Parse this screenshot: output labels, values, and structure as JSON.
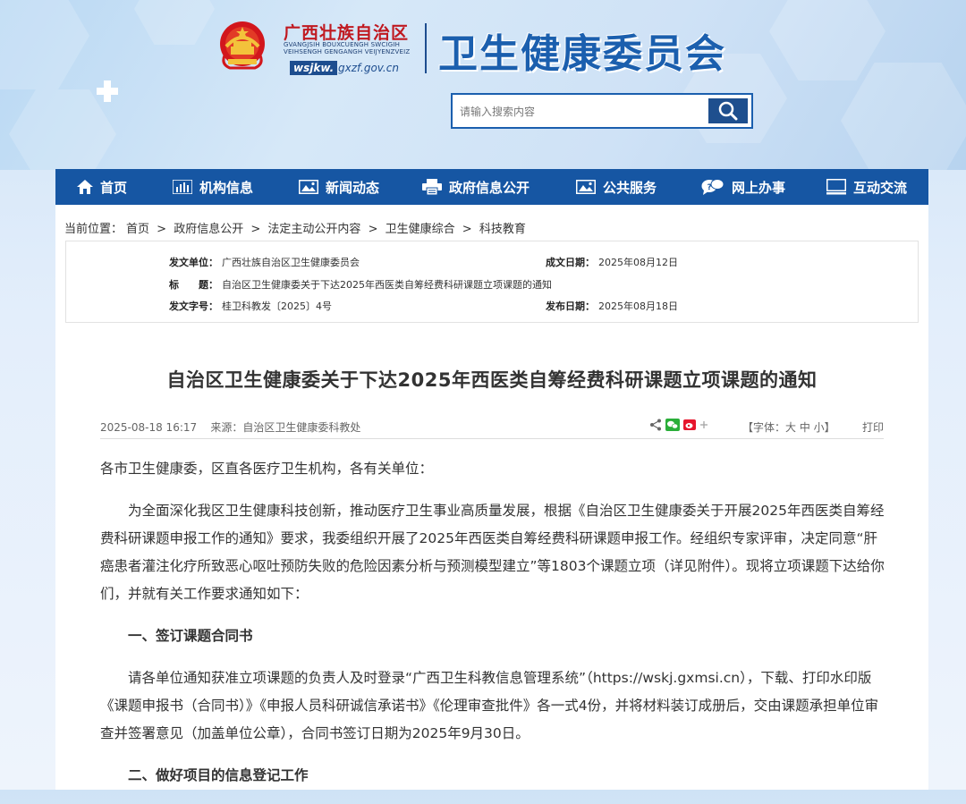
{
  "header": {
    "region_cn": "广西壮族自治区",
    "region_zh_lines": [
      "GVANGJSIH BOUXCUENGH SWCIGIH",
      "VEIHSENGH GENGANGH VEIJYENZVEIZ"
    ],
    "url_prefix": "wsjkw.",
    "url_rest": "gxzf.gov.cn",
    "org_title": "卫生健康委员会"
  },
  "search": {
    "placeholder": "请输入搜索内容",
    "button_icon": "search-icon"
  },
  "nav": {
    "items": [
      {
        "label": "首页",
        "icon": "home-icon"
      },
      {
        "label": "机构信息",
        "icon": "bar-chart-icon"
      },
      {
        "label": "新闻动态",
        "icon": "image-icon"
      },
      {
        "label": "政府信息公开",
        "icon": "printer-icon"
      },
      {
        "label": "公共服务",
        "icon": "image-icon"
      },
      {
        "label": "网上办事",
        "icon": "chat-icon"
      },
      {
        "label": "互动交流",
        "icon": "monitor-icon"
      }
    ]
  },
  "breadcrumb": {
    "prefix": "当前位置：",
    "items": [
      "首页",
      "政府信息公开",
      "法定主动公开内容",
      "卫生健康综合",
      "科技教育"
    ],
    "separator": ">"
  },
  "meta": {
    "issuer_label": "发文单位：",
    "issuer": "广西壮族自治区卫生健康委员会",
    "date_formed_label": "成文日期：",
    "date_formed": "2025年08月12日",
    "title_label": "标　　题：",
    "title": "自治区卫生健康委关于下达2025年西医类自筹经费科研课题立项课题的通知",
    "doc_no_label": "发文字号：",
    "doc_no": "桂卫科教发〔2025〕4号",
    "publish_label": "发布日期：",
    "publish_date": "2025年08月18日"
  },
  "article": {
    "title": "自治区卫生健康委关于下达2025年西医类自筹经费科研课题立项课题的通知",
    "datetime": "2025-08-18 16:17",
    "source": "来源：自治区卫生健康委科教处",
    "font_size_label": "【字体：大 中 小】",
    "print_label": "打印",
    "salutation": "各市卫生健康委，区直各医疗卫生机构，各有关单位：",
    "para1": "为全面深化我区卫生健康科技创新，推动医疗卫生事业高质量发展，根据《自治区卫生健康委关于开展2025年西医类自筹经费科研课题申报工作的通知》要求，我委组织开展了2025年西医类自筹经费科研课题申报工作。经组织专家评审，决定同意“肝癌患者灌注化疗所致恶心呕吐预防失败的危险因素分析与预测模型建立”等1803个课题立项（详见附件）。现将立项课题下达给你们，并就有关工作要求通知如下：",
    "section1": "一、签订课题合同书",
    "para2": "请各单位通知获准立项课题的负责人及时登录“广西卫生科教信息管理系统”（https://wskj.gxmsi.cn），下载、打印水印版《课题申报书（合同书）》《申报人员科研诚信承诺书》《伦理审查批件》各一式4份，并将材料装订成册后，交由课题承担单位审查并签署意见（加盖单位公章），合同书签订日期为2025年9月30日。",
    "section2": "二、做好项目的信息登记工作"
  },
  "colors": {
    "nav_bg": "#1656a3",
    "title_blue": "#1b5fae",
    "region_red": "#c01920"
  }
}
